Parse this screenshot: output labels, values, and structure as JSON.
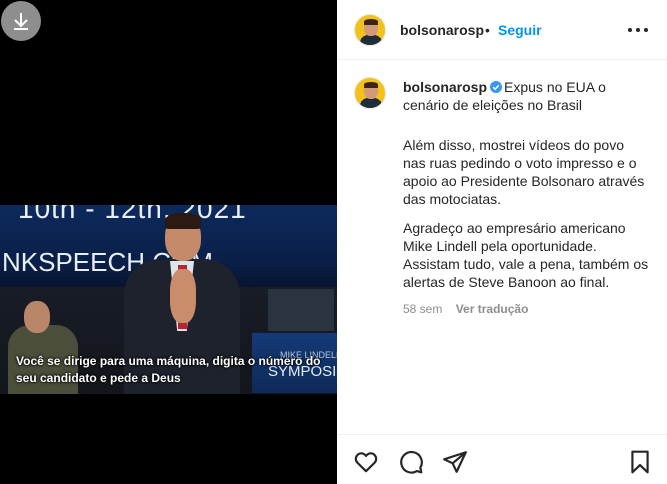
{
  "media": {
    "banner_date": "10th - 12th, 2021",
    "banner_site": "NKSPEECH.COM",
    "sign_small": "MIKE LINDELL",
    "sign_word": "SYMPOSIUM",
    "subtitle_line1": "Você se dirige para uma máquina, digita o número do",
    "subtitle_line2": "seu candidato e pede a Deus"
  },
  "header": {
    "username": "bolsonarosp",
    "separator": "•",
    "follow_label": "Seguir"
  },
  "caption": {
    "username": "bolsonarosp",
    "first_text": "Expus no EUA o cenário de eleições no Brasil",
    "paragraph2": "Além disso, mostrei vídeos do povo nas ruas pedindo o voto impresso e o apoio ao Presidente Bolsonaro através das motociatas.",
    "paragraph3": "Agradeço ao empresário americano Mike Lindell pela oportunidade. Assistam tudo, vale a pena, também os alertas de Steve Banoon ao final.",
    "time": "58 sem",
    "translate_label": "Ver tradução"
  },
  "icons": {
    "download": "download-icon",
    "more": "more-options-icon",
    "verified": "verified-badge-icon",
    "like": "heart-icon",
    "comment": "comment-icon",
    "share": "share-icon",
    "save": "bookmark-icon"
  },
  "colors": {
    "follow": "#0095f6",
    "verified": "#3897f0",
    "muted": "#8e8e8e",
    "avatar_bg": "#f3c21a"
  }
}
